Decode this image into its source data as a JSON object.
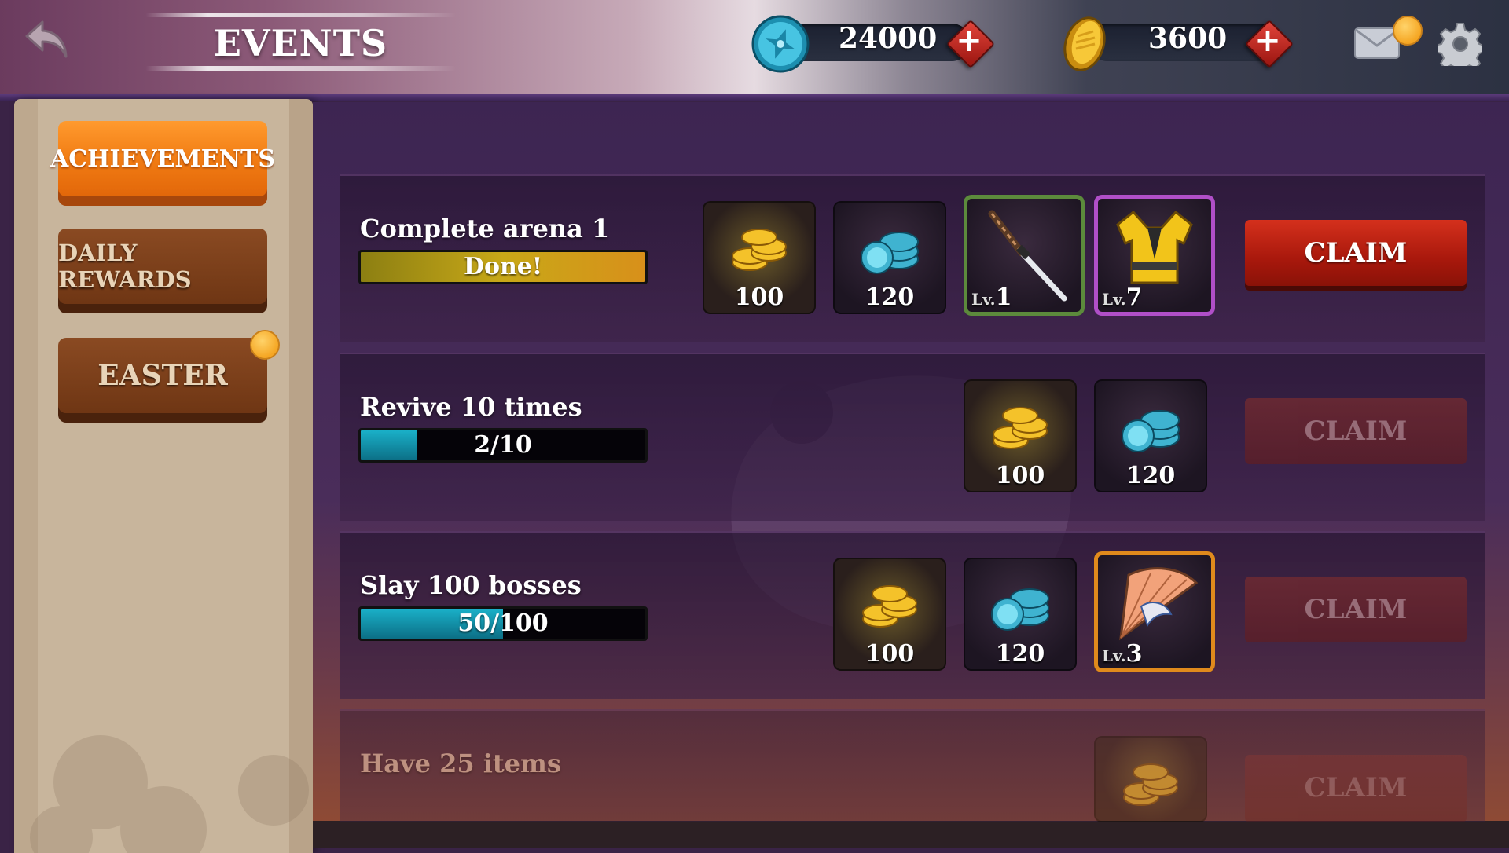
{
  "header": {
    "title": "EVENTS",
    "back_icon": "back-arrow-icon",
    "gems": {
      "value": "24000",
      "icon": "shuriken-gem-icon",
      "plus": "+"
    },
    "coins": {
      "value": "3600",
      "icon": "gold-coin-icon",
      "plus": "+"
    },
    "mail_icon": "mail-icon",
    "settings_icon": "gear-icon"
  },
  "sidebar": {
    "tabs": [
      {
        "label": "ACHIEVEMENTS",
        "active": true
      },
      {
        "label": "DAILY REWARDS",
        "active": false
      },
      {
        "label": "EASTER",
        "active": false,
        "notification": true
      }
    ]
  },
  "achievements": [
    {
      "title": "Complete arena 1",
      "progress_text": "Done!",
      "progress": 1.0,
      "rewards": [
        {
          "type": "gold-coins",
          "qty": "100"
        },
        {
          "type": "gems",
          "qty": "120"
        },
        {
          "type": "katana",
          "level_prefix": "Lv.",
          "level": "1",
          "rarity": "green"
        },
        {
          "type": "armor",
          "level_prefix": "Lv.",
          "level": "7",
          "rarity": "purple"
        }
      ],
      "claim_label": "CLAIM",
      "claim_enabled": true
    },
    {
      "title": "Revive 10 times",
      "progress_text": "2/10",
      "progress": 0.2,
      "rewards": [
        {
          "type": "gold-coins",
          "qty": "100"
        },
        {
          "type": "gems",
          "qty": "120"
        }
      ],
      "claim_label": "CLAIM",
      "claim_enabled": false
    },
    {
      "title": "Slay 100 bosses",
      "progress_text": "50/100",
      "progress": 0.5,
      "rewards": [
        {
          "type": "gold-coins",
          "qty": "100"
        },
        {
          "type": "gems",
          "qty": "120"
        },
        {
          "type": "fan",
          "level_prefix": "Lv.",
          "level": "3",
          "rarity": "orange"
        }
      ],
      "claim_label": "CLAIM",
      "claim_enabled": false
    },
    {
      "title": "Have 25 items",
      "rewards": [
        {
          "type": "gold-coins"
        }
      ],
      "claim_label": "CLAIM",
      "claim_enabled": false
    }
  ],
  "colors": {
    "accent_orange": "#f07a12",
    "claim_red": "#a8180c",
    "progress_done": "#b8a010",
    "progress_teal": "#1aa0b8",
    "notification": "#f5a623"
  }
}
